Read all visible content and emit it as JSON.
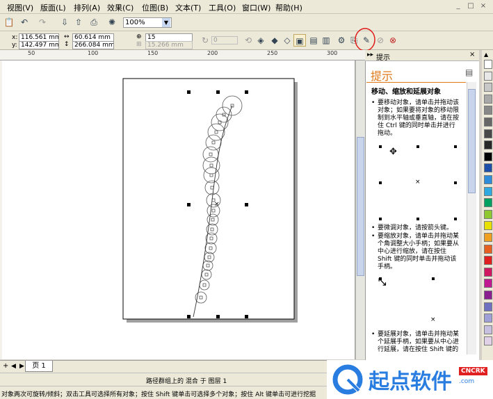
{
  "menubar": {
    "items": [
      "视图(V)",
      "版面(L)",
      "排列(A)",
      "效果(C)",
      "位图(B)",
      "文本(T)",
      "工具(O)",
      "窗口(W)",
      "帮助(H)"
    ],
    "window_controls": [
      "_",
      "□",
      "×"
    ]
  },
  "toolbar1": {
    "zoom_value": "100%"
  },
  "toolbar2": {
    "x_label": "x:",
    "y_label": "y:",
    "x_value": "116.561 mm",
    "y_value": "142.497 mm",
    "width_value": "60.614 mm",
    "height_value": "266.084 mm",
    "steps_value": "15",
    "offset_value": "15.266 mm",
    "rotation_value": "0"
  },
  "ruler": {
    "ticks": [
      "50",
      "100",
      "150",
      "200",
      "250",
      "300"
    ]
  },
  "docker": {
    "tab_label": "提示",
    "header_title": "提示",
    "section_title": "移动、缩放和延展对象",
    "tip1": [
      "要移动对象，请单击并拖动该",
      "对象；如果要将对象的移动限",
      "制到水平轴或垂直轴，请在按",
      "住 Ctrl 键的同时单击并进行",
      "拖动。"
    ],
    "tip2": [
      "要微调对象，请按箭头键。"
    ],
    "tip3": [
      "要缩放对象，请单击并拖动某",
      "个角调整大小手柄；如果要从",
      "中心进行缩放，请在按住",
      "Shift 键的同时单击并拖动该",
      "手柄。"
    ],
    "tip4": [
      "要延展对象，请单击并拖动某",
      "个延展手柄，如果要从中心进",
      "行延展，请在按住 Shift 键的"
    ]
  },
  "palette": {
    "colors": [
      "#ffffff",
      "#e8e8e8",
      "#c8c8c8",
      "#a8a8a8",
      "#888888",
      "#686868",
      "#484848",
      "#282828",
      "#000000",
      "#1e4fa8",
      "#2f8cd8",
      "#30a8e0",
      "#00a060",
      "#90c830",
      "#e8e000",
      "#f0a020",
      "#e86020",
      "#e02020",
      "#d01860",
      "#c01890",
      "#8a2090",
      "#7070c0",
      "#a0a0d8",
      "#c8c0e0",
      "#e0d0e8"
    ]
  },
  "pagetabs": {
    "page_label": "页 1"
  },
  "status": {
    "line1": "路径群组上的 混合 于 图层 1",
    "line2": "对象两次可旋转/倾斜；双击工具可选择所有对象；按住 Shift 键单击可选择多个对象；按住 Alt 键单击可进行挖掘"
  },
  "watermark": {
    "text": "起点软件",
    "badge": "CNCRK",
    "suffix": ".com"
  }
}
